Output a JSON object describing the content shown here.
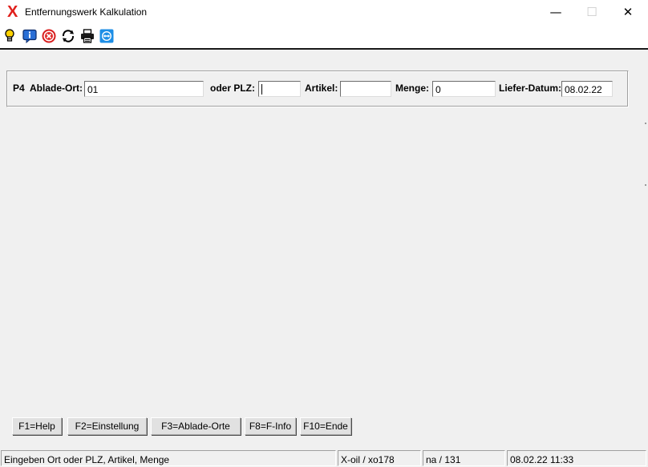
{
  "window": {
    "title": "Entfernungswerk Kalkulation",
    "icon_glyph": "X",
    "controls": {
      "minimize": "—",
      "maximize": "☐",
      "close": "✕"
    }
  },
  "toolbar": {
    "icons": [
      "lightbulb-icon",
      "info-icon",
      "cancel-icon",
      "refresh-icon",
      "print-icon",
      "teamviewer-icon"
    ]
  },
  "form": {
    "prefix": "P4",
    "ablade_ort_label": "Ablade-Ort:",
    "ablade_ort_value": "01",
    "plz_label": "oder PLZ:",
    "plz_value": "",
    "artikel_label": "Artikel:",
    "artikel_value": "",
    "menge_label": "Menge:",
    "menge_value": "0",
    "liefer_datum_label": "Liefer-Datum:",
    "liefer_datum_value": "08.02.22"
  },
  "function_keys": {
    "f1": "F1=Help",
    "f2": "F2=Einstellung",
    "f3": "F3=Ablade-Orte",
    "f8": "F8=F-Info",
    "f10": "F10=Ende"
  },
  "statusbar": {
    "message": "Eingeben Ort oder PLZ, Artikel, Menge",
    "system": "X-oil / xo178",
    "user": "na / 131",
    "datetime": "08.02.22 11:33"
  },
  "colors": {
    "app_icon": "#e0201c",
    "background": "#f0f0f0",
    "button_face": "#e1e1e1"
  }
}
